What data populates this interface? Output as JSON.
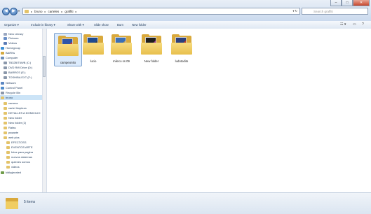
{
  "window": {
    "minimize": "–",
    "maximize": "□",
    "close": "✕"
  },
  "nav": {
    "back": "◀",
    "forward": "▶",
    "dropdown": "▾"
  },
  "address": {
    "crumbs": [
      "bruno",
      "carteles",
      "graffiti"
    ],
    "separator": "▸",
    "dropdown": "▾",
    "refresh": "▾ ↻"
  },
  "search": {
    "placeholder": "Search graffiti",
    "icon": "search-icon"
  },
  "toolbar": {
    "organize": "Organize ▾",
    "include": "Include in library ▾",
    "share": "Share with ▾",
    "slideshow": "Slide show",
    "burn": "Burn",
    "newfolder": "New folder",
    "view": "☷ ▾",
    "preview": "▭",
    "help": "?"
  },
  "sidebar": {
    "items": [
      {
        "label": "New Library",
        "icon": "library-icon",
        "color": "#9aa7c0"
      },
      {
        "label": "Pictures",
        "icon": "pictures-icon",
        "color": "#6a8fc7"
      },
      {
        "label": "Videos",
        "icon": "videos-icon",
        "color": "#5b7bb5"
      },
      {
        "label": "Homegroup",
        "icon": "homegroup-icon",
        "color": "#3c8fd6"
      },
      {
        "label": "BARNs",
        "icon": "user-icon",
        "color": "#d4a93d"
      },
      {
        "label": "Computer",
        "icon": "computer-icon",
        "color": "#6b8db8"
      },
      {
        "label": "TB32BIT6WB (C:)",
        "icon": "drive-icon",
        "color": "#8a97aa"
      },
      {
        "label": "DVD RW Drive (D:)",
        "icon": "dvd-icon",
        "color": "#8a97aa"
      },
      {
        "label": "BARROS (E:)",
        "icon": "drive-icon",
        "color": "#8a97aa"
      },
      {
        "label": "TOSHIBA EXT (F:)",
        "icon": "drive-icon",
        "color": "#8a97aa"
      },
      {
        "label": "Network",
        "icon": "network-icon",
        "color": "#5a86c2"
      },
      {
        "label": "Control Panel",
        "icon": "control-panel-icon",
        "color": "#4f8bcb"
      },
      {
        "label": "Recycle Bin",
        "icon": "recycle-bin-icon",
        "color": "#8a97aa"
      },
      {
        "label": "bruno",
        "icon": "folder-icon",
        "color": "#e3c36a"
      },
      {
        "label": "camera",
        "icon": "folder-icon",
        "color": "#e3c36a"
      },
      {
        "label": "cartel limpieza",
        "icon": "folder-icon",
        "color": "#e3c36a"
      },
      {
        "label": "DETALLES A DOMICILIO",
        "icon": "folder-icon",
        "color": "#e3c36a"
      },
      {
        "label": "New folder",
        "icon": "folder-icon",
        "color": "#e3c36a"
      },
      {
        "label": "New folder (2)",
        "icon": "folder-icon",
        "color": "#e3c36a"
      },
      {
        "label": "Rafas",
        "icon": "folder-icon",
        "color": "#e3c36a"
      },
      {
        "label": "pasante",
        "icon": "folder-icon",
        "color": "#e3c36a"
      },
      {
        "label": "web pics",
        "icon": "folder-icon",
        "color": "#e3c36a"
      },
      {
        "label": "EFECTOSS",
        "icon": "folder-icon",
        "color": "#e3c36a"
      },
      {
        "label": "EVENTOS ARTE",
        "icon": "folder-icon",
        "color": "#e3c36a"
      },
      {
        "label": "fotos para pagina",
        "icon": "folder-icon",
        "color": "#e3c36a"
      },
      {
        "label": "nuevos sistemas",
        "icon": "folder-icon",
        "color": "#e3c36a"
      },
      {
        "label": "quienes somos",
        "icon": "folder-icon",
        "color": "#e3c36a"
      },
      {
        "label": "videos",
        "icon": "folder-icon",
        "color": "#e3c36a"
      },
      {
        "label": "kidkyjeealed",
        "icon": "network-user-icon",
        "color": "#6f9c4a"
      }
    ]
  },
  "files": [
    {
      "label": "campeonito",
      "art": "#2c55a8",
      "art2": "#d13a2e"
    },
    {
      "label": "lucio",
      "art": "#1f4a8f",
      "art2": "#3a3a3a"
    },
    {
      "label": "mileco ss 09",
      "art": "#3b6fb5",
      "art2": "#c9a24a"
    },
    {
      "label": "New folder",
      "art": "#1e1e1e",
      "art2": "#a13b8c"
    },
    {
      "label": "ludotodito",
      "art": "#2b3f7d",
      "art2": "#c23b2a"
    }
  ],
  "status": {
    "count": "5 items"
  }
}
